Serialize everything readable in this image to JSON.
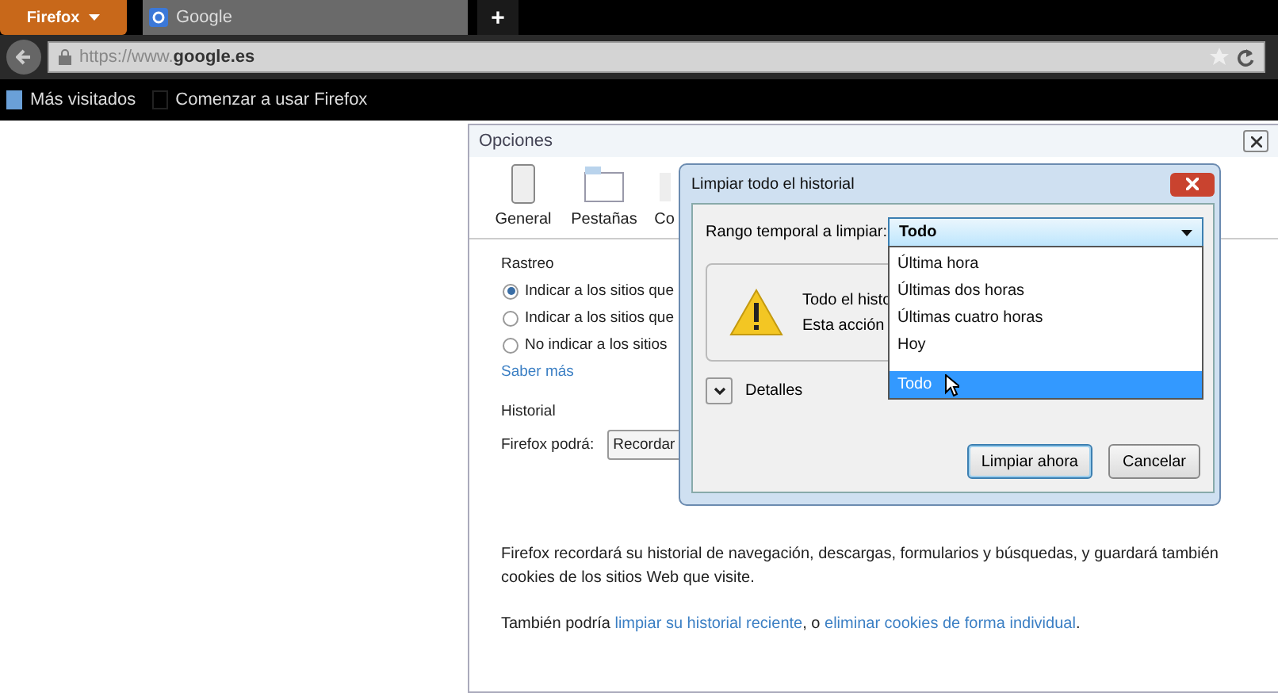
{
  "browser": {
    "menu_button": "Firefox",
    "tabs": [
      {
        "title": "Google",
        "selected": true
      }
    ],
    "new_tab": "+",
    "url_prefix": "https://www.",
    "url_domain": "google.es",
    "bookmarks": [
      {
        "label": "Más visitados"
      },
      {
        "label": "Comenzar a usar Firefox"
      }
    ]
  },
  "options_window": {
    "title": "Opciones",
    "panes": [
      {
        "label": "General",
        "selected": false
      },
      {
        "label": "Pestañas",
        "selected": false
      },
      {
        "label": "Co",
        "selected": false
      }
    ],
    "tracking": {
      "heading": "Rastreo",
      "radios": [
        {
          "label": "Indicar a los sitios que",
          "selected": true
        },
        {
          "label": "Indicar a los sitios que",
          "selected": false
        },
        {
          "label": "No indicar a los sitios",
          "selected": false
        }
      ],
      "link": "Saber más"
    },
    "history": {
      "heading": "Historial",
      "label": "Firefox podrá:",
      "value": "Recordar",
      "description": "Firefox recordará su historial de navegación, descargas, formularios y búsquedas, y guardará también cookies de los sitios Web que visite.",
      "footer_prefix": "También podría ",
      "link_1": "limpiar su historial reciente",
      "footer_middle": ", o ",
      "link_2": "eliminar cookies de forma individual",
      "footer_suffix": "."
    }
  },
  "dialog": {
    "title": "Limpiar todo el historial",
    "range_label": "Rango temporal a limpiar:",
    "range_value": "Todo",
    "warning_lines": [
      "Todo el histo",
      "Esta acción"
    ],
    "details": "Detalles",
    "details_expanded": false,
    "buttons": [
      {
        "label": "Limpiar ahora",
        "default": true
      },
      {
        "label": "Cancelar",
        "default": false
      }
    ],
    "dropdown_options": [
      {
        "label": "Última hora",
        "selected": false
      },
      {
        "label": "Últimas dos horas",
        "selected": false
      },
      {
        "label": "Últimas cuatro horas",
        "selected": false
      },
      {
        "label": "Hoy",
        "selected": false
      },
      {
        "label": "Todo",
        "selected": true
      }
    ]
  }
}
